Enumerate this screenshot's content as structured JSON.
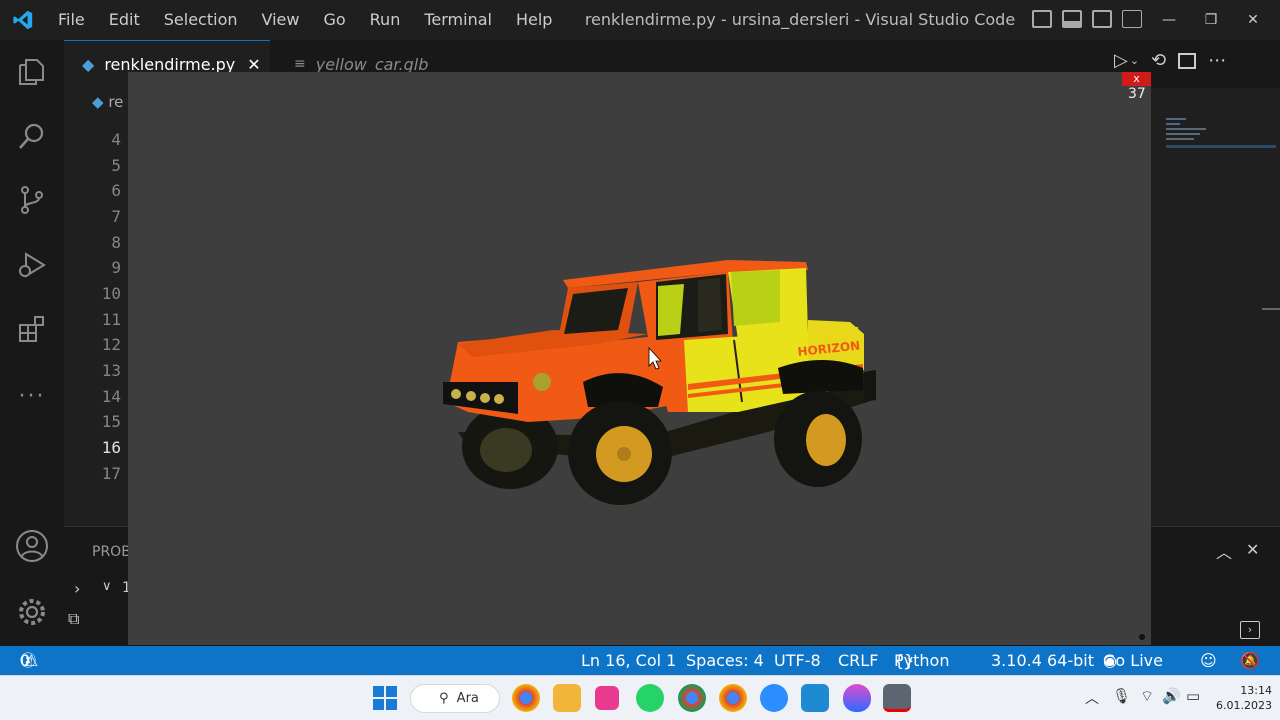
{
  "menu": [
    "File",
    "Edit",
    "Selection",
    "View",
    "Go",
    "Run",
    "Terminal",
    "Help"
  ],
  "window_title": "renklendirme.py - ursina_dersleri - Visual Studio Code",
  "tabs": [
    {
      "label": "renklendirme.py",
      "active": true
    },
    {
      "label": "yellow_car.glb",
      "active": false
    }
  ],
  "breadcrumb": "re",
  "tab_close": "✕",
  "line_numbers": [
    "4",
    "5",
    "6",
    "7",
    "8",
    "9",
    "10",
    "11",
    "12",
    "13",
    "14",
    "15",
    "16",
    "17"
  ],
  "current_line": "16",
  "viewer": {
    "close_label": "x",
    "fps": "37"
  },
  "panel": {
    "tab_label": "PROB",
    "tree_label": "1"
  },
  "status": {
    "errors": "0",
    "warnings": "0",
    "position": "Ln 16, Col 1",
    "spaces": "Spaces: 4",
    "encoding": "UTF-8",
    "eol": "CRLF",
    "language": "Python",
    "interpreter": "3.10.4 64-bit",
    "golive": "Go Live"
  },
  "taskbar": {
    "search_label": "Ara",
    "time": "13:14",
    "date": "6.01.2023"
  },
  "colors": {
    "statusbar": "#0e74c7",
    "car_orange": "#f05a14",
    "car_yellow": "#e8e21a",
    "viewer_bg": "#3e3e3e"
  }
}
